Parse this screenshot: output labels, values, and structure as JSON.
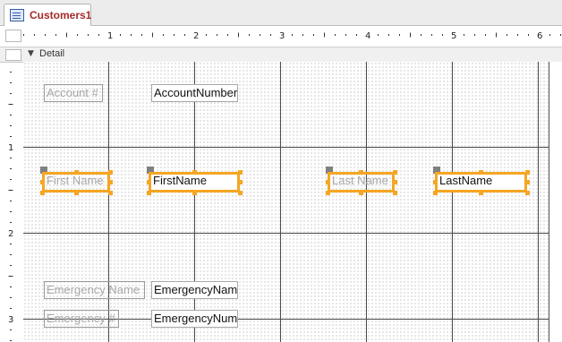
{
  "tabs": [
    {
      "label": "Customers1",
      "icon": "form-icon",
      "active": true
    }
  ],
  "section": {
    "label": "Detail",
    "arrow_icon": "section-arrow-icon"
  },
  "rulers": {
    "horizontal_numbers": [
      "1",
      "2",
      "3",
      "4",
      "5",
      "6"
    ],
    "vertical_numbers": [
      "1",
      "2",
      "3"
    ]
  },
  "colors": {
    "selection": "#f5a623",
    "tab_label": "#a52a2a",
    "grid_line": "#4a4a4a"
  },
  "form": {
    "account_label": "Account #",
    "account_field": "AccountNumber",
    "first_name_label": "First Name",
    "first_name_field": "FirstName",
    "last_name_label": "Last Name",
    "last_name_field": "LastName",
    "emergency_name_label": "Emergency Name",
    "emergency_name_field": "EmergencyName",
    "emergency_number_label": "Emergency #",
    "emergency_number_field": "EmergencyNumber"
  }
}
